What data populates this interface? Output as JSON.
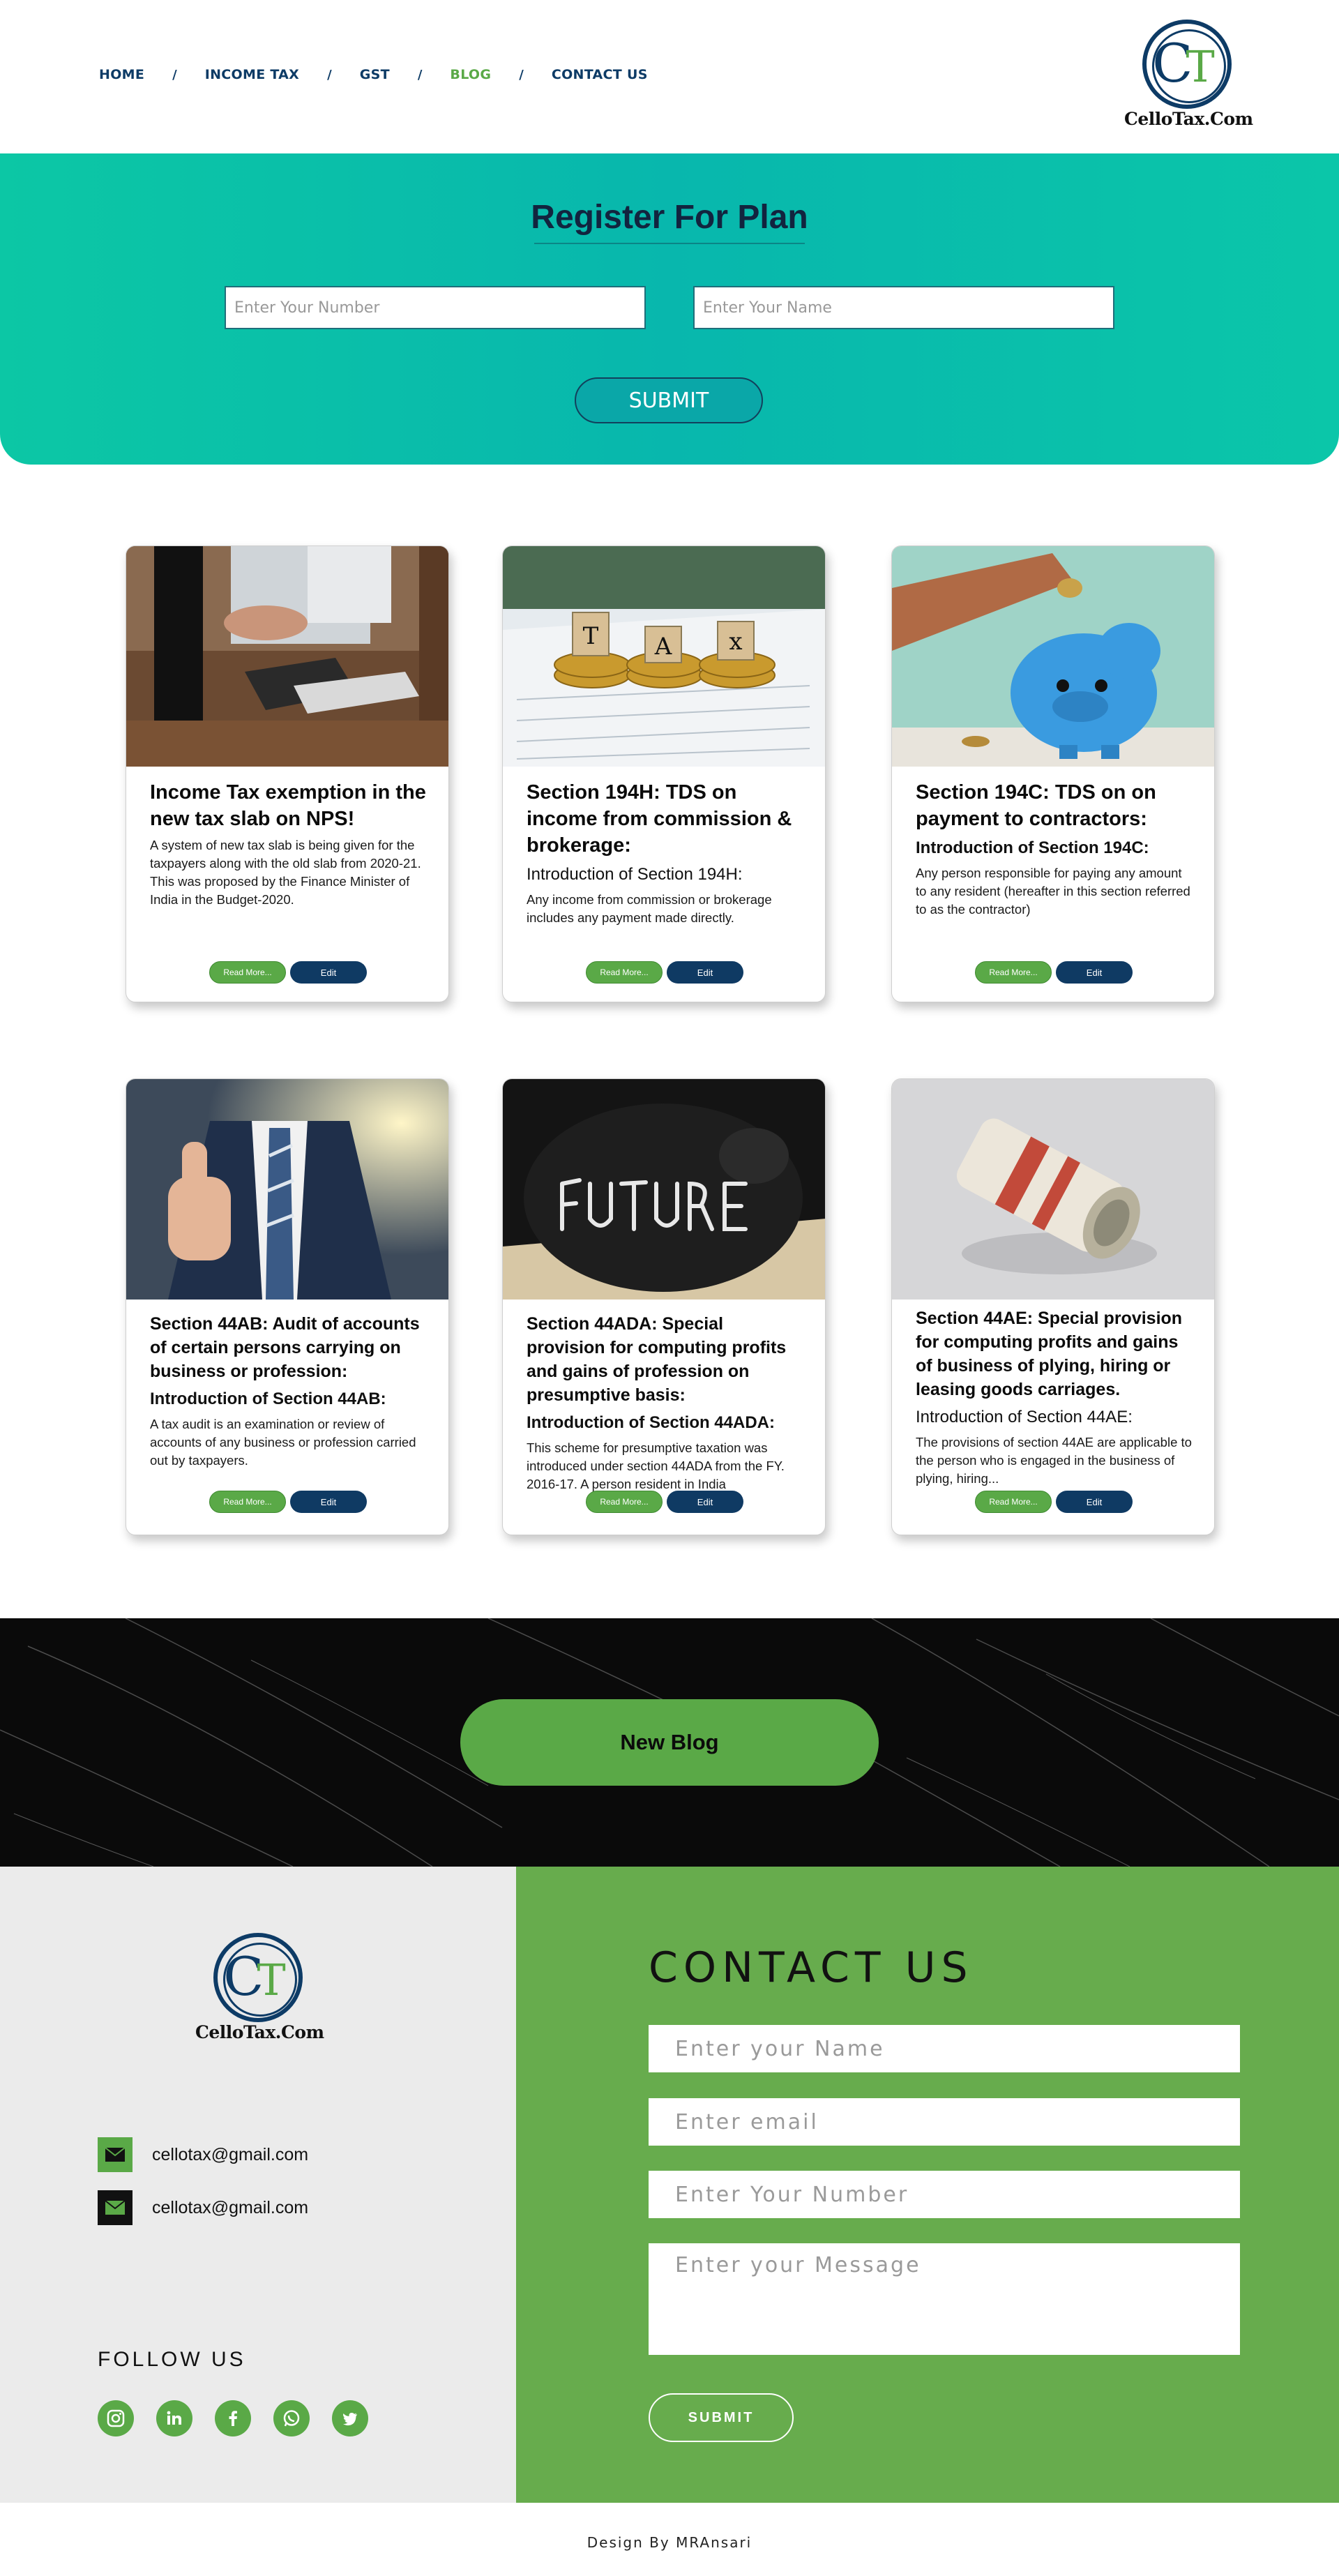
{
  "nav": {
    "items": [
      {
        "label": "HOME"
      },
      {
        "label": "INCOME TAX"
      },
      {
        "label": "GST"
      },
      {
        "label": "BLOG"
      },
      {
        "label": "CONTACT US"
      }
    ],
    "separator": "/",
    "active": "BLOG"
  },
  "brand": {
    "logo_letter": "C",
    "logo_inner": "T",
    "name": "CelloTax.Com"
  },
  "register": {
    "title": "Register For Plan",
    "number_placeholder": "Enter Your Number",
    "name_placeholder": "Enter Your Name",
    "submit_label": "SUBMIT"
  },
  "cards": [
    {
      "title": "Income Tax exemption in the new tax slab on NPS!",
      "intro": "",
      "text": "A system of new tax slab is being given for the taxpayers along with the old slab from 2020-21. This was proposed by the Finance Minister of India in the Budget-2020.",
      "image": "office-desk-laptop",
      "read_label": "Read More...",
      "edit_label": "Edit"
    },
    {
      "title": "Section 194H: TDS on income from commission & brokerage:",
      "intro": "Introduction of Section 194H:",
      "text": "Any income from commission or brokerage includes any payment made directly.",
      "image": "tax-blocks-coins",
      "read_label": "Read More...",
      "edit_label": "Edit"
    },
    {
      "title": "Section 194C: TDS on on payment to contractors:",
      "intro": "Introduction of Section 194C:",
      "text": "Any person responsible for paying any amount to any resident (hereafter in this section referred to as the contractor)",
      "image": "piggy-bank-blue",
      "read_label": "Read More...",
      "edit_label": "Edit"
    },
    {
      "title": "Section 44AB: Audit of accounts of certain persons carrying on business or profession:",
      "intro": "Introduction of Section 44AB:",
      "text": "A tax audit is an examination or review of accounts of any business or profession carried out by taxpayers.",
      "image": "businessman-thumbs-up",
      "read_label": "Read More...",
      "edit_label": "Edit"
    },
    {
      "title": "Section 44ADA: Special provision for computing profits and gains of profession on presumptive basis:",
      "intro": "Introduction of Section 44ADA:",
      "text": "This scheme for presumptive taxation was introduced under section 44ADA from the FY. 2016-17. A person resident in India",
      "image": "future-piggy-bank",
      "read_label": "Read More...",
      "edit_label": "Edit"
    },
    {
      "title": "Section 44AE: Special provision for computing profits and gains of business of plying, hiring or leasing goods carriages.",
      "intro": "Introduction of Section 44AE:",
      "text": "The provisions of section 44AE are applicable to the person who is engaged in the business of plying, hiring...",
      "image": "money-roll",
      "read_label": "Read More...",
      "edit_label": "Edit"
    }
  ],
  "new_blog": {
    "label": "New Blog"
  },
  "footer": {
    "emails": [
      "cellotax@gmail.com",
      "cellotax@gmail.com"
    ],
    "follow_label": "FOLLOW US",
    "socials": [
      "instagram-icon",
      "linkedin-icon",
      "facebook-icon",
      "whatsapp-icon",
      "twitter-icon"
    ]
  },
  "contact": {
    "title": "CONTACT US",
    "name_placeholder": "Enter your Name",
    "email_placeholder": "Enter email",
    "number_placeholder": "Enter Your Number",
    "message_placeholder": "Enter your Message",
    "submit_label": "SUBMIT"
  },
  "credit": "Design By MRAnsari",
  "colors": {
    "navy": "#0d3b66",
    "green": "#5aa947",
    "teal": "#08b7ad",
    "footer_green": "#67ac4d"
  }
}
